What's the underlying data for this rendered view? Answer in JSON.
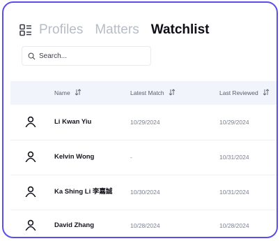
{
  "tabs": [
    {
      "label": "Profiles",
      "active": false
    },
    {
      "label": "Matters",
      "active": false
    },
    {
      "label": "Watchlist",
      "active": true
    }
  ],
  "search": {
    "placeholder": "Search..."
  },
  "table": {
    "columns": [
      "Name",
      "Latest Match",
      "Last Reviewed"
    ],
    "rows": [
      {
        "name": "Li Kwan Yiu",
        "latest_match": "10/29/2024",
        "last_reviewed": "10/29/2024"
      },
      {
        "name": "Kelvin Wong",
        "latest_match": "-",
        "last_reviewed": "10/31/2024"
      },
      {
        "name": "Ka Shing Li 李嘉誠",
        "latest_match": "10/30/2024",
        "last_reviewed": "10/31/2024"
      },
      {
        "name": "David Zhang",
        "latest_match": "10/28/2024",
        "last_reviewed": "10/28/2024"
      }
    ]
  },
  "colors": {
    "frame_border": "#5a4de8",
    "active_tab": "#0d0d16",
    "inactive_tab": "#b8bcc6",
    "header_bg": "#f1f4fb"
  },
  "icons": {
    "view_switch": "grid-list-icon",
    "search": "search-icon",
    "sort": "sort-arrows-icon",
    "profile": "user-icon"
  }
}
